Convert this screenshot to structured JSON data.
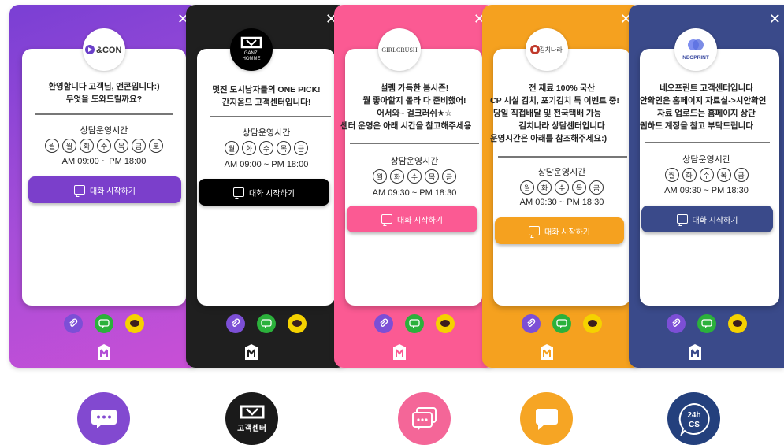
{
  "widgets": [
    {
      "brand": "&CON",
      "greeting": [
        "환영합니다 고객님, 앤콘입니다:)",
        "무엇을 도와드릴까요?"
      ],
      "hours_title": "상담운영시간",
      "days": [
        "월",
        "월",
        "화",
        "수",
        "목",
        "금",
        "토"
      ],
      "time": "AM 09:00 ~ PM 18:00",
      "button": "대화 시작하기",
      "colors": {
        "bg": "#8a44d6",
        "button": "#7b3fcb"
      }
    },
    {
      "brand": "GANZI HOMME",
      "greeting": [
        "멋진 도시남자들의 ONE PICK!",
        "간지옴므 고객센터입니다!"
      ],
      "hours_title": "상담운영시간",
      "days": [
        "월",
        "화",
        "수",
        "목",
        "금"
      ],
      "time": "AM 09:00 ~ PM 18:00",
      "button": "대화 시작하기",
      "colors": {
        "bg": "#1d1d1d",
        "button": "#000000"
      }
    },
    {
      "brand": "GIRLCRUSH",
      "greeting": [
        "설렘 가득한 봄시즌!",
        "뭘 좋아할지 몰라 다 준비했어!",
        "어서와~ 걸크러쉬★☆",
        "센터 운영은 아래 시간을 참고해주세용"
      ],
      "hours_title": "상담운영시간",
      "days": [
        "월",
        "화",
        "수",
        "목",
        "금"
      ],
      "time": "AM 09:30 ~ PM 18:30",
      "button": "대화 시작하기",
      "colors": {
        "bg": "#fb5a93",
        "button": "#fb5a93"
      }
    },
    {
      "brand": "김치나라",
      "greeting": [
        "전 재료 100% 국산",
        "CP 시설 김치, 포기김치 특 이벤트 중!",
        "당일 직접배달 및 전국택배 가능",
        "김치나라 상담센터입니다",
        "운영시간은 아래를 참조해주세요:)"
      ],
      "hours_title": "상담운영시간",
      "days": [
        "월",
        "화",
        "수",
        "목",
        "금"
      ],
      "time": "AM 09:30 ~ PM 18:30",
      "button": "대화 시작하기",
      "colors": {
        "bg": "#f5a11f",
        "button": "#f5a11f"
      }
    },
    {
      "brand": "NEOPRINT",
      "greeting": [
        "네오프린트 고객센터입니다",
        "안확인은 홈페이지 자료실->시안확인",
        "자료 업로드는 홈페이지 상단",
        "웹하드 계정을 참고 부탁드립니다"
      ],
      "hours_title": "상담운영시간",
      "days": [
        "월",
        "화",
        "수",
        "목",
        "금"
      ],
      "time": "AM 09:30 ~ PM 18:30",
      "button": "대화 시작하기",
      "colors": {
        "bg": "#3a4a8a",
        "button": "#3a4a8a"
      }
    }
  ],
  "footer_icons": [
    "paperclip-icon",
    "line-chat-icon",
    "kakao-chat-icon"
  ],
  "launchers": [
    {
      "name": "dots-chat-launcher",
      "label": "",
      "color": "#8249d0"
    },
    {
      "name": "ganzi-launcher",
      "label": "고객센터",
      "color": "#1a1a1a"
    },
    {
      "name": "pink-chat-launcher",
      "label": "",
      "color": "#f46698"
    },
    {
      "name": "orange-chat-launcher",
      "label": "",
      "color": "#f6a524"
    },
    {
      "name": "24h-cs-launcher",
      "label": "24h CS",
      "color": "#24407d"
    }
  ],
  "launcher_text": {
    "ganzi_label": "고객센터",
    "cs_top": "24h",
    "cs_bottom": "CS"
  }
}
